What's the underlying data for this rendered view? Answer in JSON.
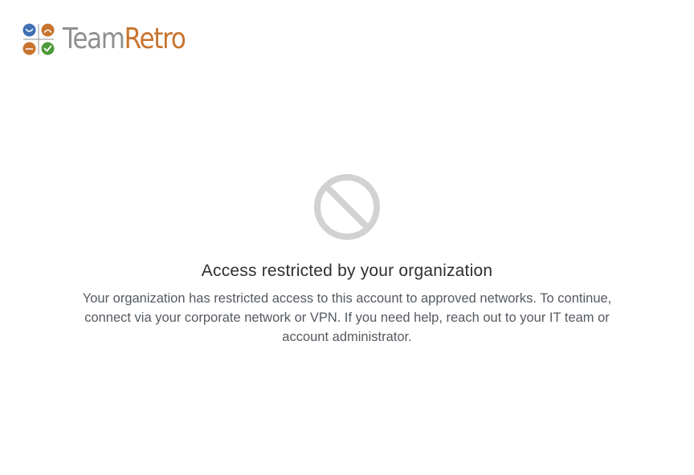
{
  "brand": {
    "name_part1": "Team",
    "name_part2": "Retro",
    "colors": {
      "blue": "#3f6fb5",
      "orange": "#c8742f",
      "green": "#4f9a3c",
      "gray": "#909090"
    }
  },
  "notice": {
    "icon": "blocked-icon",
    "title": "Access restricted by your organization",
    "message": "Your organization has restricted access to this account to approved networks. To continue, connect via your corporate network or VPN. If you need help, reach out to your IT team or account administrator."
  }
}
